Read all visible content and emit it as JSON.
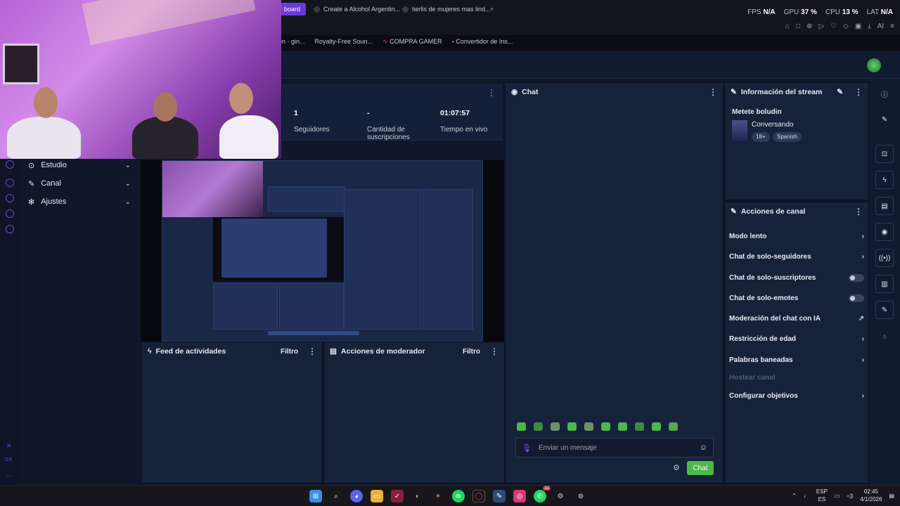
{
  "browser": {
    "tabs": [
      {
        "label": "board",
        "active": true
      },
      {
        "label": "Create a Alcohol Argentin..."
      },
      {
        "label": "tierlis de mujeres mas lind..."
      }
    ],
    "new_tab_label": "+",
    "status": {
      "fps_label": "FPS",
      "fps_value": "N/A",
      "gpu_label": "GPU",
      "gpu_value": "37 %",
      "cpu_label": "CPU",
      "cpu_value": "13 %",
      "lat_label": "LAT",
      "lat_value": "N/A"
    },
    "ai_label": "AI",
    "bookmarks": [
      "ón - gin...",
      "Royalty-Free Soun...",
      "COMPRA GAMER",
      "Convertidor de Ins..."
    ]
  },
  "nav": {
    "items": [
      {
        "label": "Estudio",
        "icon": "studio-icon"
      },
      {
        "label": "Canal",
        "icon": "channel-icon"
      },
      {
        "label": "Ajustes",
        "icon": "gear-icon"
      }
    ]
  },
  "stats": {
    "followers_value": "1",
    "followers_label": "Seguidores",
    "subs_value": "-",
    "subs_label": "Cantidad de suscripciones",
    "live_value": "01:07:57",
    "live_label": "Tiempo en vivo"
  },
  "feed": {
    "title": "Feed de actividades",
    "filter": "Filtro"
  },
  "moderator": {
    "title": "Acciones de moderador",
    "filter": "Filtro"
  },
  "chat": {
    "title": "Chat",
    "placeholder": "Enviar un mensaje",
    "send_label": "Chat",
    "emote_count": 10
  },
  "stream_info": {
    "title": "Información del stream",
    "stream_title": "Metete boludin",
    "category": "Conversando",
    "tags": [
      "18+",
      "Spanish"
    ]
  },
  "channel_actions": {
    "title": "Acciones de canal",
    "items": [
      {
        "label": "Modo lento",
        "control": "chevron"
      },
      {
        "label": "Chat de solo-seguidores",
        "control": "chevron"
      },
      {
        "label": "Chat de solo-suscriptores",
        "control": "toggle"
      },
      {
        "label": "Chat de solo-emotes",
        "control": "toggle"
      },
      {
        "label": "Moderación del chat con IA",
        "control": "external"
      },
      {
        "label": "Restricción de edad",
        "control": "chevron"
      },
      {
        "label": "Palabras baneadas",
        "control": "chevron"
      },
      {
        "label": "Hostear canal",
        "control": "none",
        "disabled": true
      },
      {
        "label": "Configurar objetivos",
        "control": "chevron"
      }
    ]
  },
  "taskbar": {
    "lang_top": "ESP",
    "lang_bottom": "ES",
    "time": "02:45",
    "date": "4/1/2026",
    "whatsapp_badge": "32"
  },
  "colors": {
    "accent": "#6a3bd6",
    "chat_send": "#4cb84a",
    "panel": "#16223a"
  }
}
